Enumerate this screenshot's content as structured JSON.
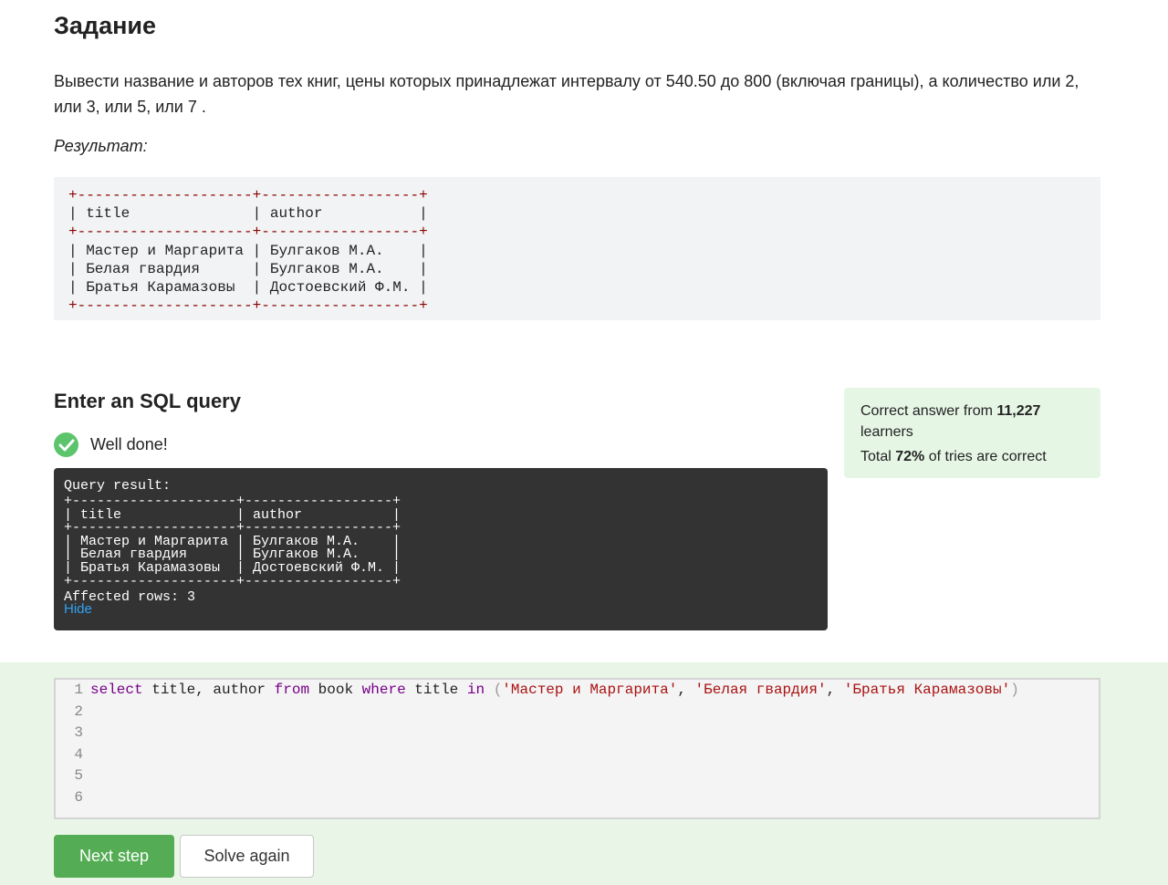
{
  "task": {
    "title": "Задание",
    "text": "Вывести название и авторов тех книг, цены которых принадлежат интервалу от 540.50 до 800 (включая границы),  а количество или 2, или 3, или 5, или 7 .",
    "result_label": "Результат:",
    "expected_table": {
      "border": "+--------------------+------------------+",
      "header": "| title              | author           |",
      "rows": [
        "| Мастер и Маргарита | Булгаков М.А.    |",
        "| Белая гвардия      | Булгаков М.А.    |",
        "| Братья Карамазовы  | Достоевский Ф.М. |"
      ]
    }
  },
  "sql": {
    "heading": "Enter an SQL query",
    "status": "Well done!",
    "status_icon": "check-circle-icon",
    "query_result": {
      "label": "Query result:",
      "border": "+--------------------+------------------+",
      "header": "| title              | author           |",
      "rows": [
        "| Мастер и Маргарита | Булгаков М.А.    |",
        "| Белая гвардия      | Булгаков М.А.    |",
        "| Братья Карамазовы  | Достоевский Ф.М. |"
      ],
      "affected": "Affected rows: 3",
      "hide_label": "Hide"
    }
  },
  "stats": {
    "line1_prefix": "Correct answer from ",
    "learners_count": "11,227",
    "line1_suffix": " learners",
    "line2_prefix": "Total ",
    "percent": "72%",
    "line2_suffix": " of tries are correct"
  },
  "editor": {
    "line_numbers": [
      "1",
      "2",
      "3",
      "4",
      "5",
      "6"
    ],
    "code": {
      "select": "select",
      "cols": " title, author ",
      "from": "from",
      "table": " book ",
      "where": "where",
      "col": " title ",
      "in": "in",
      "open": " (",
      "str1": "'Мастер и Маргарита'",
      "sep1": ", ",
      "str2": "'Белая гвардия'",
      "sep2": ", ",
      "str3": "'Братья Карамазовы'",
      "close": ")"
    }
  },
  "buttons": {
    "next": "Next step",
    "solve_again": "Solve again"
  },
  "colors": {
    "success": "#5cc46b",
    "next_button": "#54ad54",
    "stats_bg": "#e6f6e5",
    "panel_bg": "#e9f6e7",
    "link": "#2ea3f2"
  }
}
